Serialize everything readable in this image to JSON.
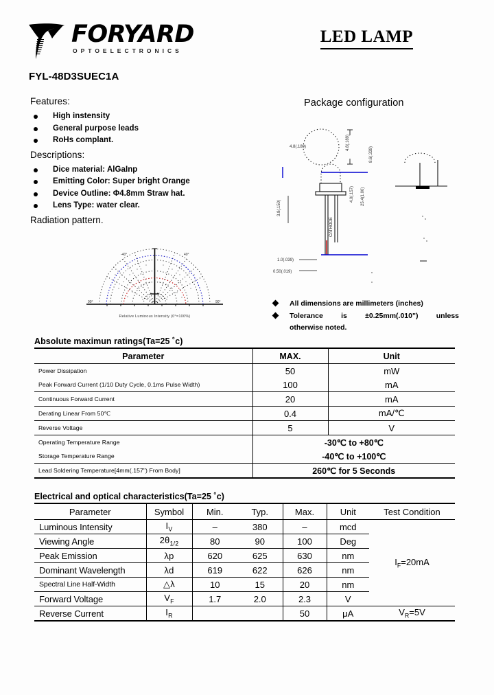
{
  "header": {
    "logo_word": "FORYARD",
    "logo_sub": "OPTOELECTRONICS",
    "doc_title": "LED LAMP",
    "part_number": "FYL-48D3SUEC1A"
  },
  "features": {
    "heading": "Features:",
    "items": [
      "High instensity",
      "General purpose leads",
      "RoHs complant."
    ]
  },
  "descriptions": {
    "heading": "Descriptions:",
    "items": [
      "Dice material: AlGaInp",
      "Emitting Color: Super bright Orange",
      "Device Outline: Φ4.8mm Straw hat.",
      "Lens Type: water clear."
    ]
  },
  "radiation": {
    "heading": "Radiation pattern.",
    "caption": "Relative Luminous Intensity (0°=100%)"
  },
  "package": {
    "title": "Package configuration",
    "notes": [
      "All dimensions are millimeters (inches)",
      "Tolerance   is   ±0.25mm(.010\")   unless",
      "otherwise noted."
    ]
  },
  "abs_table": {
    "caption": "Absolute maximun ratings(Ta=25  ˚c)",
    "headers": [
      "Parameter",
      "MAX.",
      "Unit"
    ],
    "rows": [
      {
        "parameter": "Power Dissipation",
        "max": "50",
        "unit": "mW",
        "span": false
      },
      {
        "parameter": "Peak Forward Current (1/10 Duty Cycle, 0.1ms Pulse Width)",
        "max": "100",
        "unit": "mA",
        "span": false
      },
      {
        "parameter": "Continuous Forward Current",
        "max": "20",
        "unit": "mA",
        "span": false
      },
      {
        "parameter": "Derating Linear From 50℃",
        "max": "0.4",
        "unit": "mA/℃",
        "span": false
      },
      {
        "parameter": "Reverse Voltage",
        "max": "5",
        "unit": "V",
        "span": false
      },
      {
        "parameter": "Operating Temperature Range",
        "value": "-30℃ to +80℃",
        "span": true
      },
      {
        "parameter": "Storage Temperature Range",
        "value": "-40℃ to +100℃",
        "span": true
      },
      {
        "parameter": "Lead Soldering Temperature[4mm(.157\") From Body]",
        "value": "260℃ for 5 Seconds",
        "span": true
      }
    ]
  },
  "eo_table": {
    "caption": "Electrical and optical characteristics(Ta=25  ˚c)",
    "headers": [
      "Parameter",
      "Symbol",
      "Min.",
      "Typ.",
      "Max.",
      "Unit",
      "Test Condition"
    ],
    "rows": [
      {
        "parameter": "Luminous Intensity",
        "symbol": "Iv",
        "min": "–",
        "typ": "380",
        "max": "–",
        "unit": "mcd"
      },
      {
        "parameter": "Viewing Angle",
        "symbol": "2θ1/2",
        "min": "80",
        "typ": "90",
        "max": "100",
        "unit": "Deg"
      },
      {
        "parameter": "Peak Emission",
        "symbol": "λp",
        "min": "620",
        "typ": "625",
        "max": "630",
        "unit": "nm"
      },
      {
        "parameter": "Dominant Wavelength",
        "symbol": "λd",
        "min": "619",
        "typ": "622",
        "max": "626",
        "unit": "nm"
      },
      {
        "parameter": "Spectral Line Half-Width",
        "symbol": "△λ",
        "min": "10",
        "typ": "15",
        "max": "20",
        "unit": "nm"
      },
      {
        "parameter": "Forward Voltage",
        "symbol": "VF",
        "min": "1.7",
        "typ": "2.0",
        "max": "2.3",
        "unit": "V"
      },
      {
        "parameter": "Reverse Current",
        "symbol": "IR",
        "min": "",
        "typ": "",
        "max": "50",
        "unit": "μA"
      }
    ],
    "test_condition_main": "IF=20mA",
    "test_condition_reverse": "VR=5V"
  },
  "colors": {
    "ink": "#000000",
    "dimension_blue": "#0000d0",
    "accent_red": "#d00000",
    "paper": "#fdfdfd"
  }
}
